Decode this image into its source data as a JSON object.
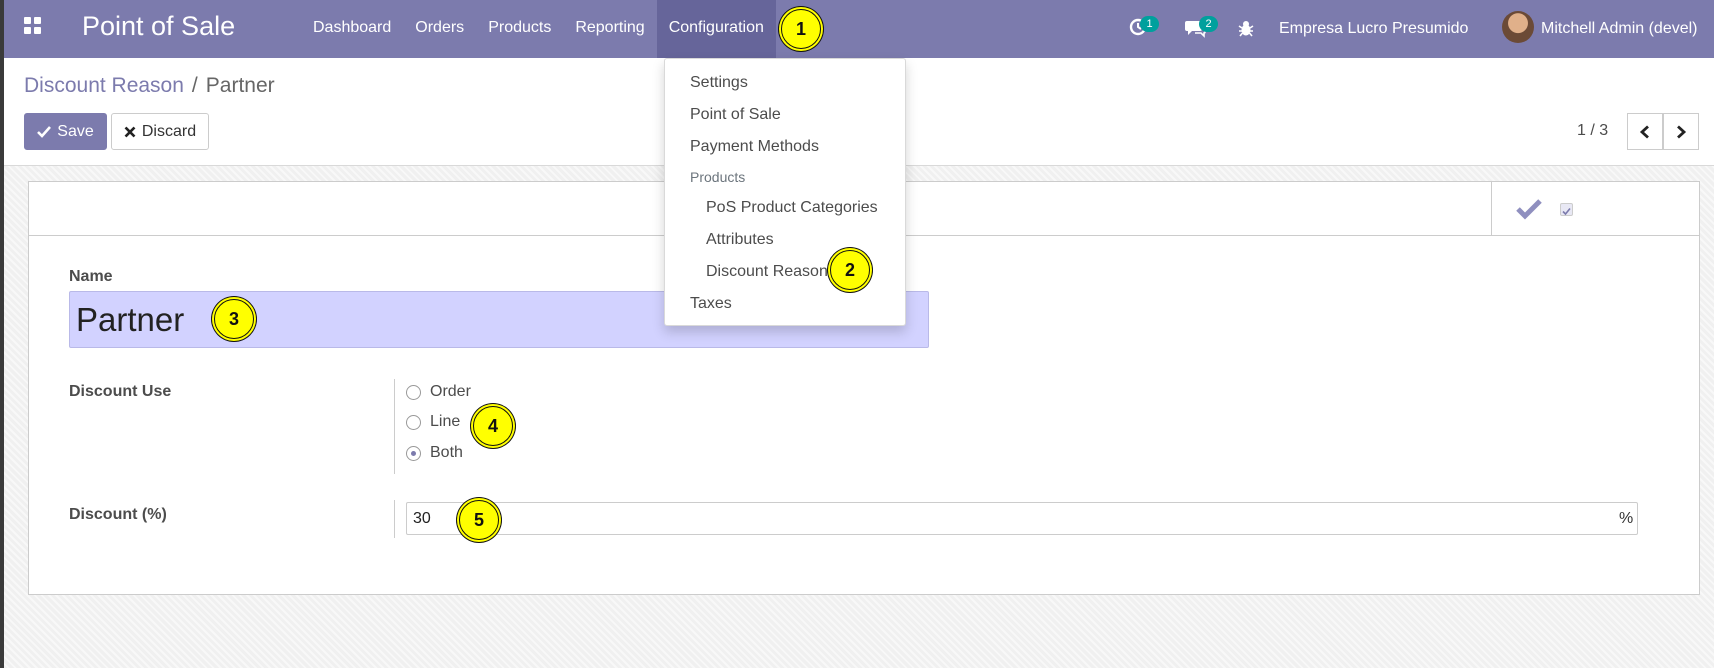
{
  "navbar": {
    "brand": "Point of Sale",
    "menu": [
      "Dashboard",
      "Orders",
      "Products",
      "Reporting",
      "Configuration"
    ],
    "active_menu": "Configuration",
    "activity_count": "1",
    "message_count": "2",
    "company": "Empresa Lucro Presumido",
    "user": "Mitchell Admin (devel)"
  },
  "breadcrumb": {
    "parent": "Discount Reason",
    "separator": "/",
    "current": "Partner"
  },
  "buttons": {
    "save": "Save",
    "discard": "Discard"
  },
  "pager": {
    "value": "1 / 3"
  },
  "form": {
    "name_label": "Name",
    "name_value": "Partner",
    "discount_use_label": "Discount Use",
    "discount_use_options": [
      "Order",
      "Line",
      "Both"
    ],
    "discount_use_selected": "Both",
    "discount_label": "Discount (%)",
    "discount_value": "30",
    "discount_suffix": "%"
  },
  "dropdown": {
    "items": [
      "Settings",
      "Point of Sale",
      "Payment Methods"
    ],
    "section_header": "Products",
    "section_items": [
      "PoS Product Categories",
      "Attributes",
      "Discount Reason"
    ],
    "last_item": "Taxes"
  },
  "markers": [
    "1",
    "2",
    "3",
    "4",
    "5"
  ],
  "colors": {
    "brand": "#7c7bad",
    "badge": "#00a09d",
    "name_field_bg": "#d2d2ff",
    "marker": "#ffff00"
  }
}
